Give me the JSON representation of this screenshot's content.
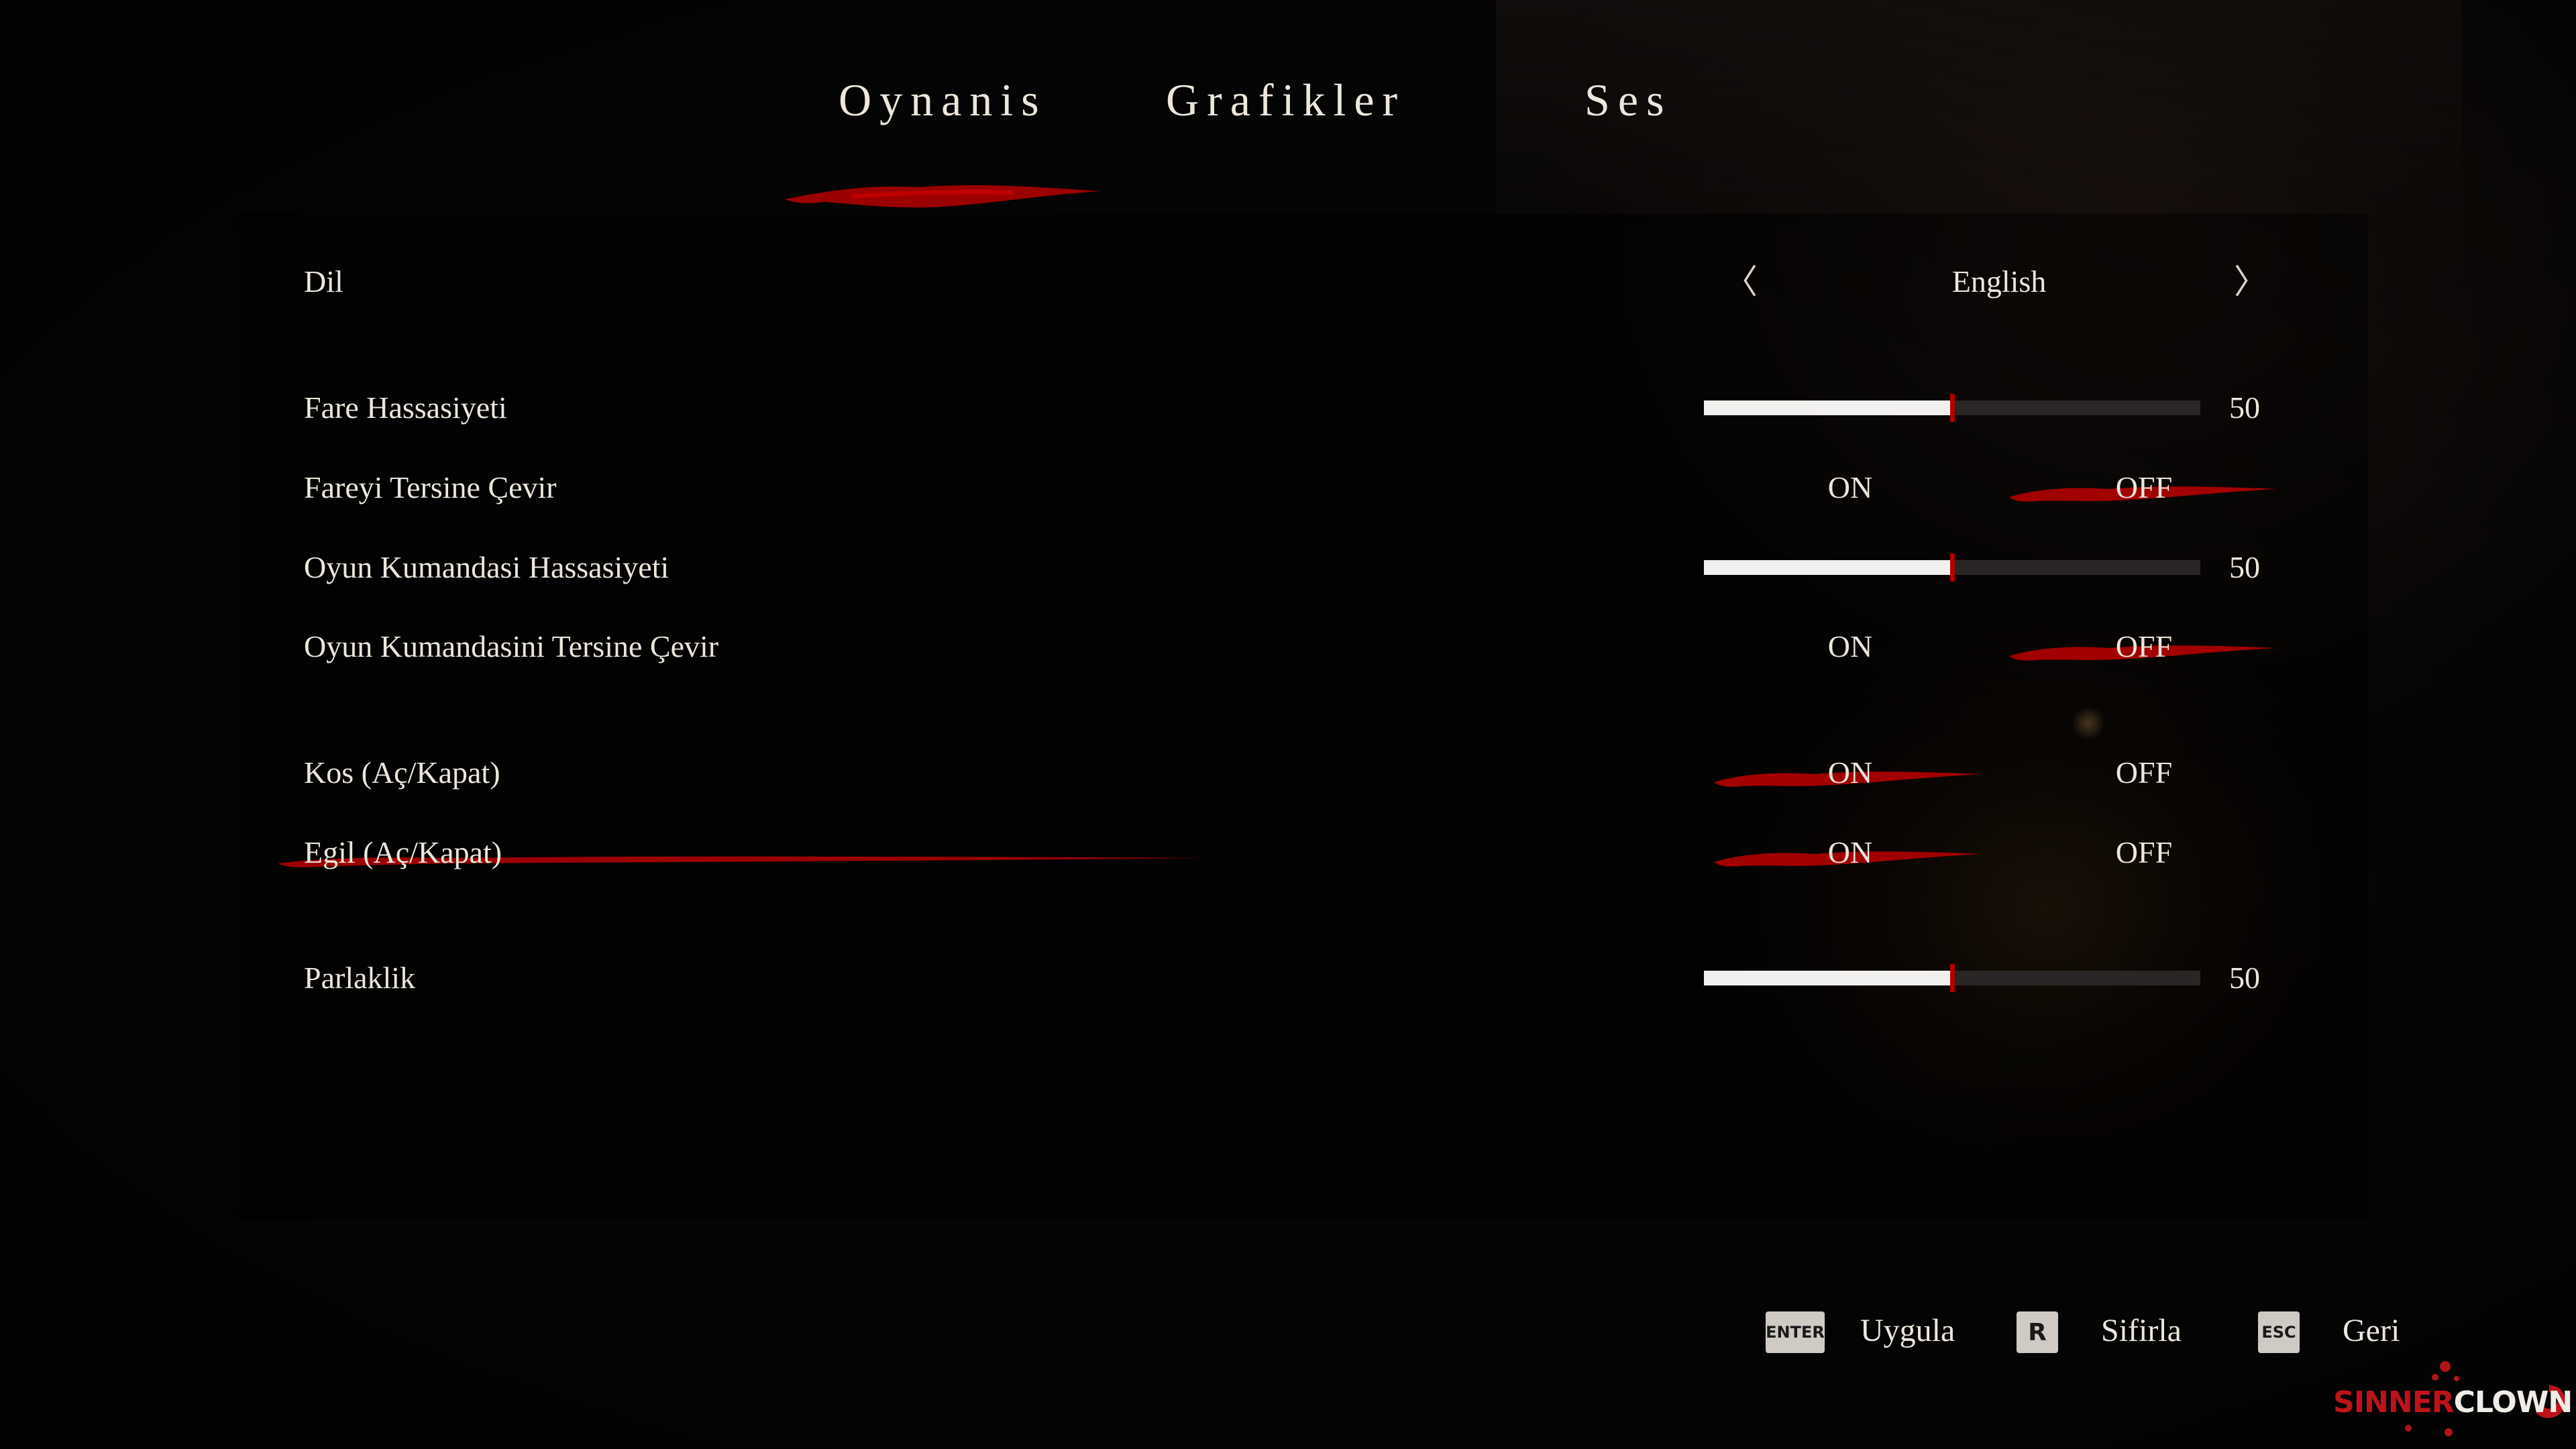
{
  "tabs": [
    {
      "label": "Oynanis",
      "active": true
    },
    {
      "label": "Grafikler",
      "active": false
    },
    {
      "label": "Ses",
      "active": false
    }
  ],
  "settings": {
    "language": {
      "label": "Dil",
      "value": "English",
      "prev_glyph": "〈",
      "next_glyph": "〉"
    },
    "mouse_sensitivity": {
      "label": "Fare Hassasiyeti",
      "value": 50
    },
    "invert_mouse": {
      "label": "Fareyi Tersine Çevir",
      "on_label": "ON",
      "off_label": "OFF",
      "selected": "OFF"
    },
    "gamepad_sensitivity": {
      "label": "Oyun Kumandasi Hassasiyeti",
      "value": 50
    },
    "invert_gamepad": {
      "label": "Oyun Kumandasini Tersine Çevir",
      "on_label": "ON",
      "off_label": "OFF",
      "selected": "OFF"
    },
    "run_toggle": {
      "label": "Kos (Aç/Kapat)",
      "on_label": "ON",
      "off_label": "OFF",
      "selected": "ON"
    },
    "crouch_toggle": {
      "label": "Egil (Aç/Kapat)",
      "on_label": "ON",
      "off_label": "OFF",
      "selected": "ON",
      "focused": true
    },
    "brightness": {
      "label": "Parlaklik",
      "value": 50
    }
  },
  "footer": {
    "apply": {
      "key": "ENTER",
      "label": "Uygula"
    },
    "reset": {
      "key": "R",
      "label": "Sifirla"
    },
    "back": {
      "key": "ESC",
      "label": "Geri"
    }
  },
  "logo": {
    "part1": "SINNER",
    "part2": "CLOWN"
  },
  "colors": {
    "accent_red": "#b30000",
    "text": "#ece6dc",
    "background": "#060505"
  }
}
